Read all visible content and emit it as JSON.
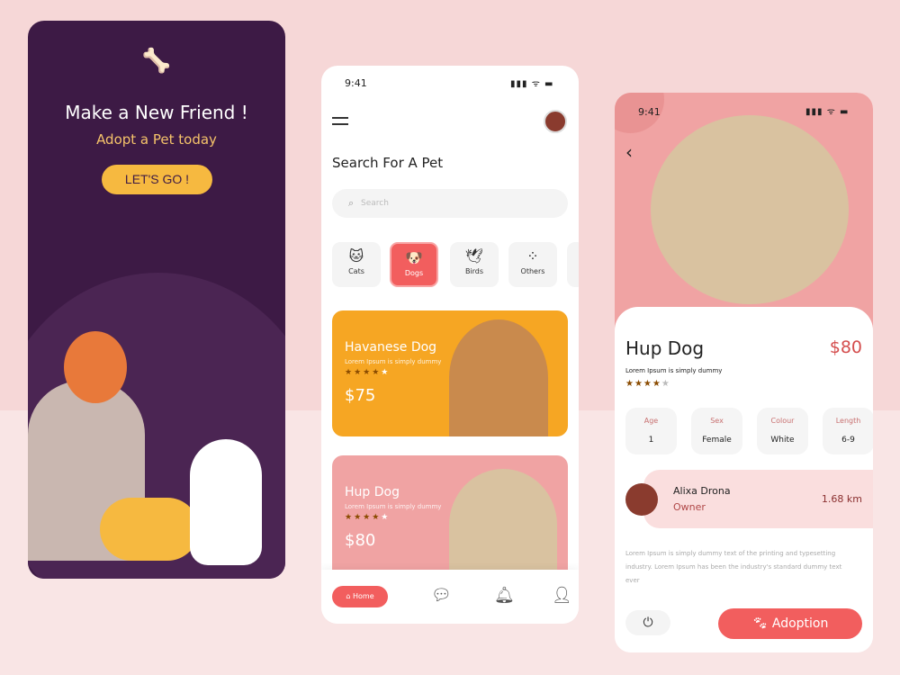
{
  "welcome": {
    "title": "Make a New Friend !",
    "subtitle": "Adopt a Pet today",
    "cta": "LET'S GO !"
  },
  "search_screen": {
    "time": "9:41",
    "status": "▮▮▮ ᯤ ▬",
    "title": "Search For A Pet",
    "search_placeholder": "Search",
    "categories": [
      {
        "label": "Cats",
        "icon": "cat-icon"
      },
      {
        "label": "Dogs",
        "icon": "dog-icon",
        "active": true
      },
      {
        "label": "Birds",
        "icon": "bird-icon"
      },
      {
        "label": "Others",
        "icon": "dots-icon"
      }
    ],
    "cards": [
      {
        "name": "Havanese Dog",
        "desc": "Lorem Ipsum is simply dummy",
        "rating": 4,
        "price": "$75",
        "color": "#f6a623"
      },
      {
        "name": "Hup Dog",
        "desc": "Lorem Ipsum is simply dummy",
        "rating": 4,
        "price": "$80",
        "color": "#f0a3a3"
      }
    ],
    "nav": {
      "home": "Home"
    }
  },
  "detail": {
    "time": "9:41",
    "name": "Hup Dog",
    "price": "$80",
    "desc": "Lorem Ipsum is simply dummy",
    "rating": 4,
    "attributes": [
      {
        "label": "Age",
        "value": "1"
      },
      {
        "label": "Sex",
        "value": "Female"
      },
      {
        "label": "Colour",
        "value": "White"
      },
      {
        "label": "Length",
        "value": "6-9"
      }
    ],
    "owner": {
      "name": "Alixa Drona",
      "role": "Owner",
      "distance": "1.68 km"
    },
    "body": "Lorem Ipsum is simply dummy text of the printing and typesetting industry. Lorem Ipsum has been the industry's standard dummy text ever",
    "adopt": "Adoption"
  },
  "colors": {
    "accent": "#f25e5e",
    "purple": "#3d1a45",
    "yellow": "#f6b940",
    "pink": "#f0a3a3",
    "star": "#8a4b00"
  }
}
